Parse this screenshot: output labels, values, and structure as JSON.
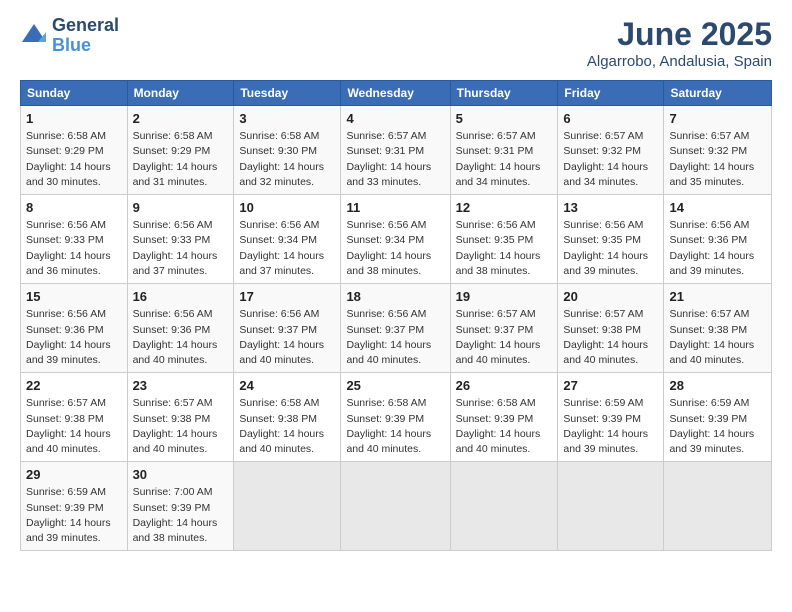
{
  "header": {
    "logo_line1": "General",
    "logo_line2": "Blue",
    "month": "June 2025",
    "location": "Algarrobo, Andalusia, Spain"
  },
  "weekdays": [
    "Sunday",
    "Monday",
    "Tuesday",
    "Wednesday",
    "Thursday",
    "Friday",
    "Saturday"
  ],
  "weeks": [
    [
      {
        "day": "1",
        "info": "Sunrise: 6:58 AM\nSunset: 9:29 PM\nDaylight: 14 hours\nand 30 minutes."
      },
      {
        "day": "2",
        "info": "Sunrise: 6:58 AM\nSunset: 9:29 PM\nDaylight: 14 hours\nand 31 minutes."
      },
      {
        "day": "3",
        "info": "Sunrise: 6:58 AM\nSunset: 9:30 PM\nDaylight: 14 hours\nand 32 minutes."
      },
      {
        "day": "4",
        "info": "Sunrise: 6:57 AM\nSunset: 9:31 PM\nDaylight: 14 hours\nand 33 minutes."
      },
      {
        "day": "5",
        "info": "Sunrise: 6:57 AM\nSunset: 9:31 PM\nDaylight: 14 hours\nand 34 minutes."
      },
      {
        "day": "6",
        "info": "Sunrise: 6:57 AM\nSunset: 9:32 PM\nDaylight: 14 hours\nand 34 minutes."
      },
      {
        "day": "7",
        "info": "Sunrise: 6:57 AM\nSunset: 9:32 PM\nDaylight: 14 hours\nand 35 minutes."
      }
    ],
    [
      {
        "day": "8",
        "info": "Sunrise: 6:56 AM\nSunset: 9:33 PM\nDaylight: 14 hours\nand 36 minutes."
      },
      {
        "day": "9",
        "info": "Sunrise: 6:56 AM\nSunset: 9:33 PM\nDaylight: 14 hours\nand 37 minutes."
      },
      {
        "day": "10",
        "info": "Sunrise: 6:56 AM\nSunset: 9:34 PM\nDaylight: 14 hours\nand 37 minutes."
      },
      {
        "day": "11",
        "info": "Sunrise: 6:56 AM\nSunset: 9:34 PM\nDaylight: 14 hours\nand 38 minutes."
      },
      {
        "day": "12",
        "info": "Sunrise: 6:56 AM\nSunset: 9:35 PM\nDaylight: 14 hours\nand 38 minutes."
      },
      {
        "day": "13",
        "info": "Sunrise: 6:56 AM\nSunset: 9:35 PM\nDaylight: 14 hours\nand 39 minutes."
      },
      {
        "day": "14",
        "info": "Sunrise: 6:56 AM\nSunset: 9:36 PM\nDaylight: 14 hours\nand 39 minutes."
      }
    ],
    [
      {
        "day": "15",
        "info": "Sunrise: 6:56 AM\nSunset: 9:36 PM\nDaylight: 14 hours\nand 39 minutes."
      },
      {
        "day": "16",
        "info": "Sunrise: 6:56 AM\nSunset: 9:36 PM\nDaylight: 14 hours\nand 40 minutes."
      },
      {
        "day": "17",
        "info": "Sunrise: 6:56 AM\nSunset: 9:37 PM\nDaylight: 14 hours\nand 40 minutes."
      },
      {
        "day": "18",
        "info": "Sunrise: 6:56 AM\nSunset: 9:37 PM\nDaylight: 14 hours\nand 40 minutes."
      },
      {
        "day": "19",
        "info": "Sunrise: 6:57 AM\nSunset: 9:37 PM\nDaylight: 14 hours\nand 40 minutes."
      },
      {
        "day": "20",
        "info": "Sunrise: 6:57 AM\nSunset: 9:38 PM\nDaylight: 14 hours\nand 40 minutes."
      },
      {
        "day": "21",
        "info": "Sunrise: 6:57 AM\nSunset: 9:38 PM\nDaylight: 14 hours\nand 40 minutes."
      }
    ],
    [
      {
        "day": "22",
        "info": "Sunrise: 6:57 AM\nSunset: 9:38 PM\nDaylight: 14 hours\nand 40 minutes."
      },
      {
        "day": "23",
        "info": "Sunrise: 6:57 AM\nSunset: 9:38 PM\nDaylight: 14 hours\nand 40 minutes."
      },
      {
        "day": "24",
        "info": "Sunrise: 6:58 AM\nSunset: 9:38 PM\nDaylight: 14 hours\nand 40 minutes."
      },
      {
        "day": "25",
        "info": "Sunrise: 6:58 AM\nSunset: 9:39 PM\nDaylight: 14 hours\nand 40 minutes."
      },
      {
        "day": "26",
        "info": "Sunrise: 6:58 AM\nSunset: 9:39 PM\nDaylight: 14 hours\nand 40 minutes."
      },
      {
        "day": "27",
        "info": "Sunrise: 6:59 AM\nSunset: 9:39 PM\nDaylight: 14 hours\nand 39 minutes."
      },
      {
        "day": "28",
        "info": "Sunrise: 6:59 AM\nSunset: 9:39 PM\nDaylight: 14 hours\nand 39 minutes."
      }
    ],
    [
      {
        "day": "29",
        "info": "Sunrise: 6:59 AM\nSunset: 9:39 PM\nDaylight: 14 hours\nand 39 minutes."
      },
      {
        "day": "30",
        "info": "Sunrise: 7:00 AM\nSunset: 9:39 PM\nDaylight: 14 hours\nand 38 minutes."
      },
      {
        "day": "",
        "info": ""
      },
      {
        "day": "",
        "info": ""
      },
      {
        "day": "",
        "info": ""
      },
      {
        "day": "",
        "info": ""
      },
      {
        "day": "",
        "info": ""
      }
    ]
  ]
}
